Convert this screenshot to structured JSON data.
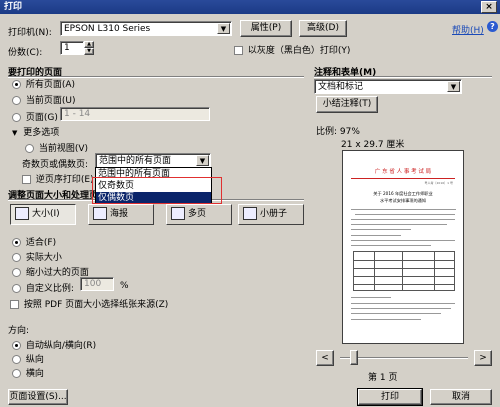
{
  "title": "打印",
  "close_glyph": "×",
  "printer": {
    "label": "打印机(N):",
    "value": "EPSON L310 Series",
    "properties": "属性(P)",
    "advanced": "高级(D)",
    "help": "帮助(H)"
  },
  "copies": {
    "label": "份数(C):",
    "value": "1"
  },
  "grayscale": {
    "label": "以灰度（黑白色）打印(Y)",
    "checked": false
  },
  "pages": {
    "title": "要打印的页面",
    "all": "所有页面(A)",
    "current": "当前页面(U)",
    "range_label": "页面(G)",
    "range_value": "1 - 14",
    "more": "更多选项",
    "current_view": "当前视图(V)",
    "odd_even_label": "奇数页或偶数页:",
    "odd_even_value": "范围中的所有页面",
    "reverse": "逆页序打印(E)",
    "dropdown_options": [
      "范围中的所有页面",
      "仅奇数页",
      "仅偶数页"
    ],
    "selected_index": 2
  },
  "sizing": {
    "title": "调整页面大小和处理页",
    "tabs": [
      "大小(I)",
      "海报",
      "多页",
      "小册子"
    ],
    "fit": "适合(F)",
    "actual": "实际大小",
    "shrink": "缩小过大的页面",
    "custom_label": "自定义比例:",
    "custom_value": "100",
    "percent": "%",
    "pdf_paper": "按照 PDF 页面大小选择纸张来源(Z)"
  },
  "orientation": {
    "title": "方向:",
    "auto": "自动纵向/横向(R)",
    "portrait": "纵向",
    "landscape": "横向"
  },
  "comments": {
    "title": "注释和表单(M)",
    "value": "文档和标记",
    "summarize": "小结注释(T)"
  },
  "preview": {
    "scale": "比例: 97%",
    "size": "21 x 29.7 厘米",
    "doc_header": "广 东 省 人 事 考 试 局",
    "doc_small": "粤人考〔2016〕1 号",
    "doc_title": "关于 2016 年度社会工作师职业",
    "doc_subtitle": "水平考试安排事项的通知",
    "page_info": "第 1 页",
    "prev": "<",
    "next": ">"
  },
  "footer": {
    "page_setup": "页面设置(S)...",
    "print": "打印",
    "cancel": "取消"
  },
  "colors": {
    "title_bar": "#1b3a86",
    "dialog_bg": "#d4d0c8",
    "selection": "#0a246a",
    "doc_header_red": "#cc2222",
    "help_link": "#1a4ab8",
    "highlight_box": "#e03030"
  }
}
